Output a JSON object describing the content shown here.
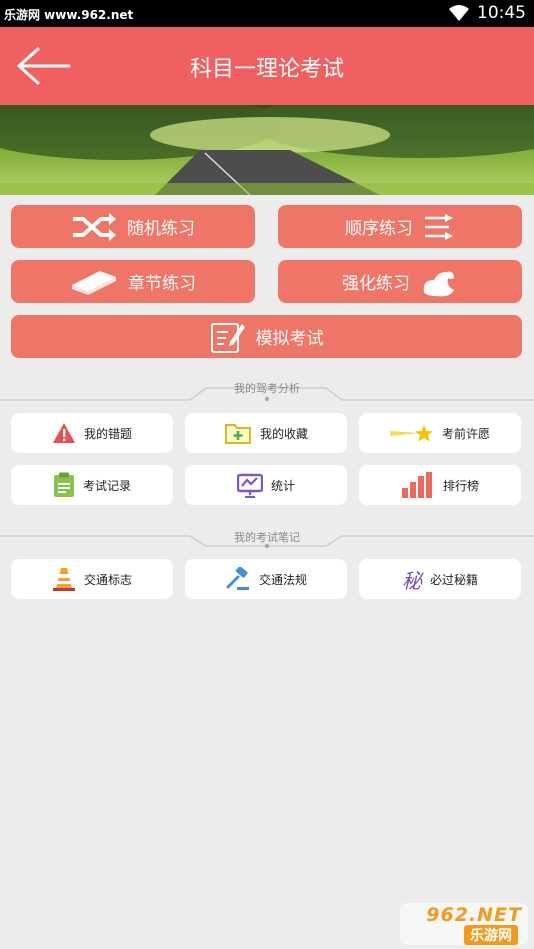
{
  "status_bar": {
    "source_text": "乐游网 www.962.net",
    "time": "10:45"
  },
  "header": {
    "title": "科目一理论考试"
  },
  "practice": {
    "random": "随机练习",
    "sequential": "顺序练习",
    "chapter": "章节练习",
    "intensive": "强化练习",
    "mock_exam": "模拟考试"
  },
  "analysis": {
    "section_title": "我的驾考分析",
    "items": [
      "我的错题",
      "我的收藏",
      "考前许愿",
      "考试记录",
      "统计",
      "排行榜"
    ]
  },
  "notes": {
    "section_title": "我的考试笔记",
    "items": [
      "交通标志",
      "交通法规",
      "必过秘籍"
    ]
  },
  "watermark": {
    "brand": "962.NET",
    "name": "乐游网"
  }
}
